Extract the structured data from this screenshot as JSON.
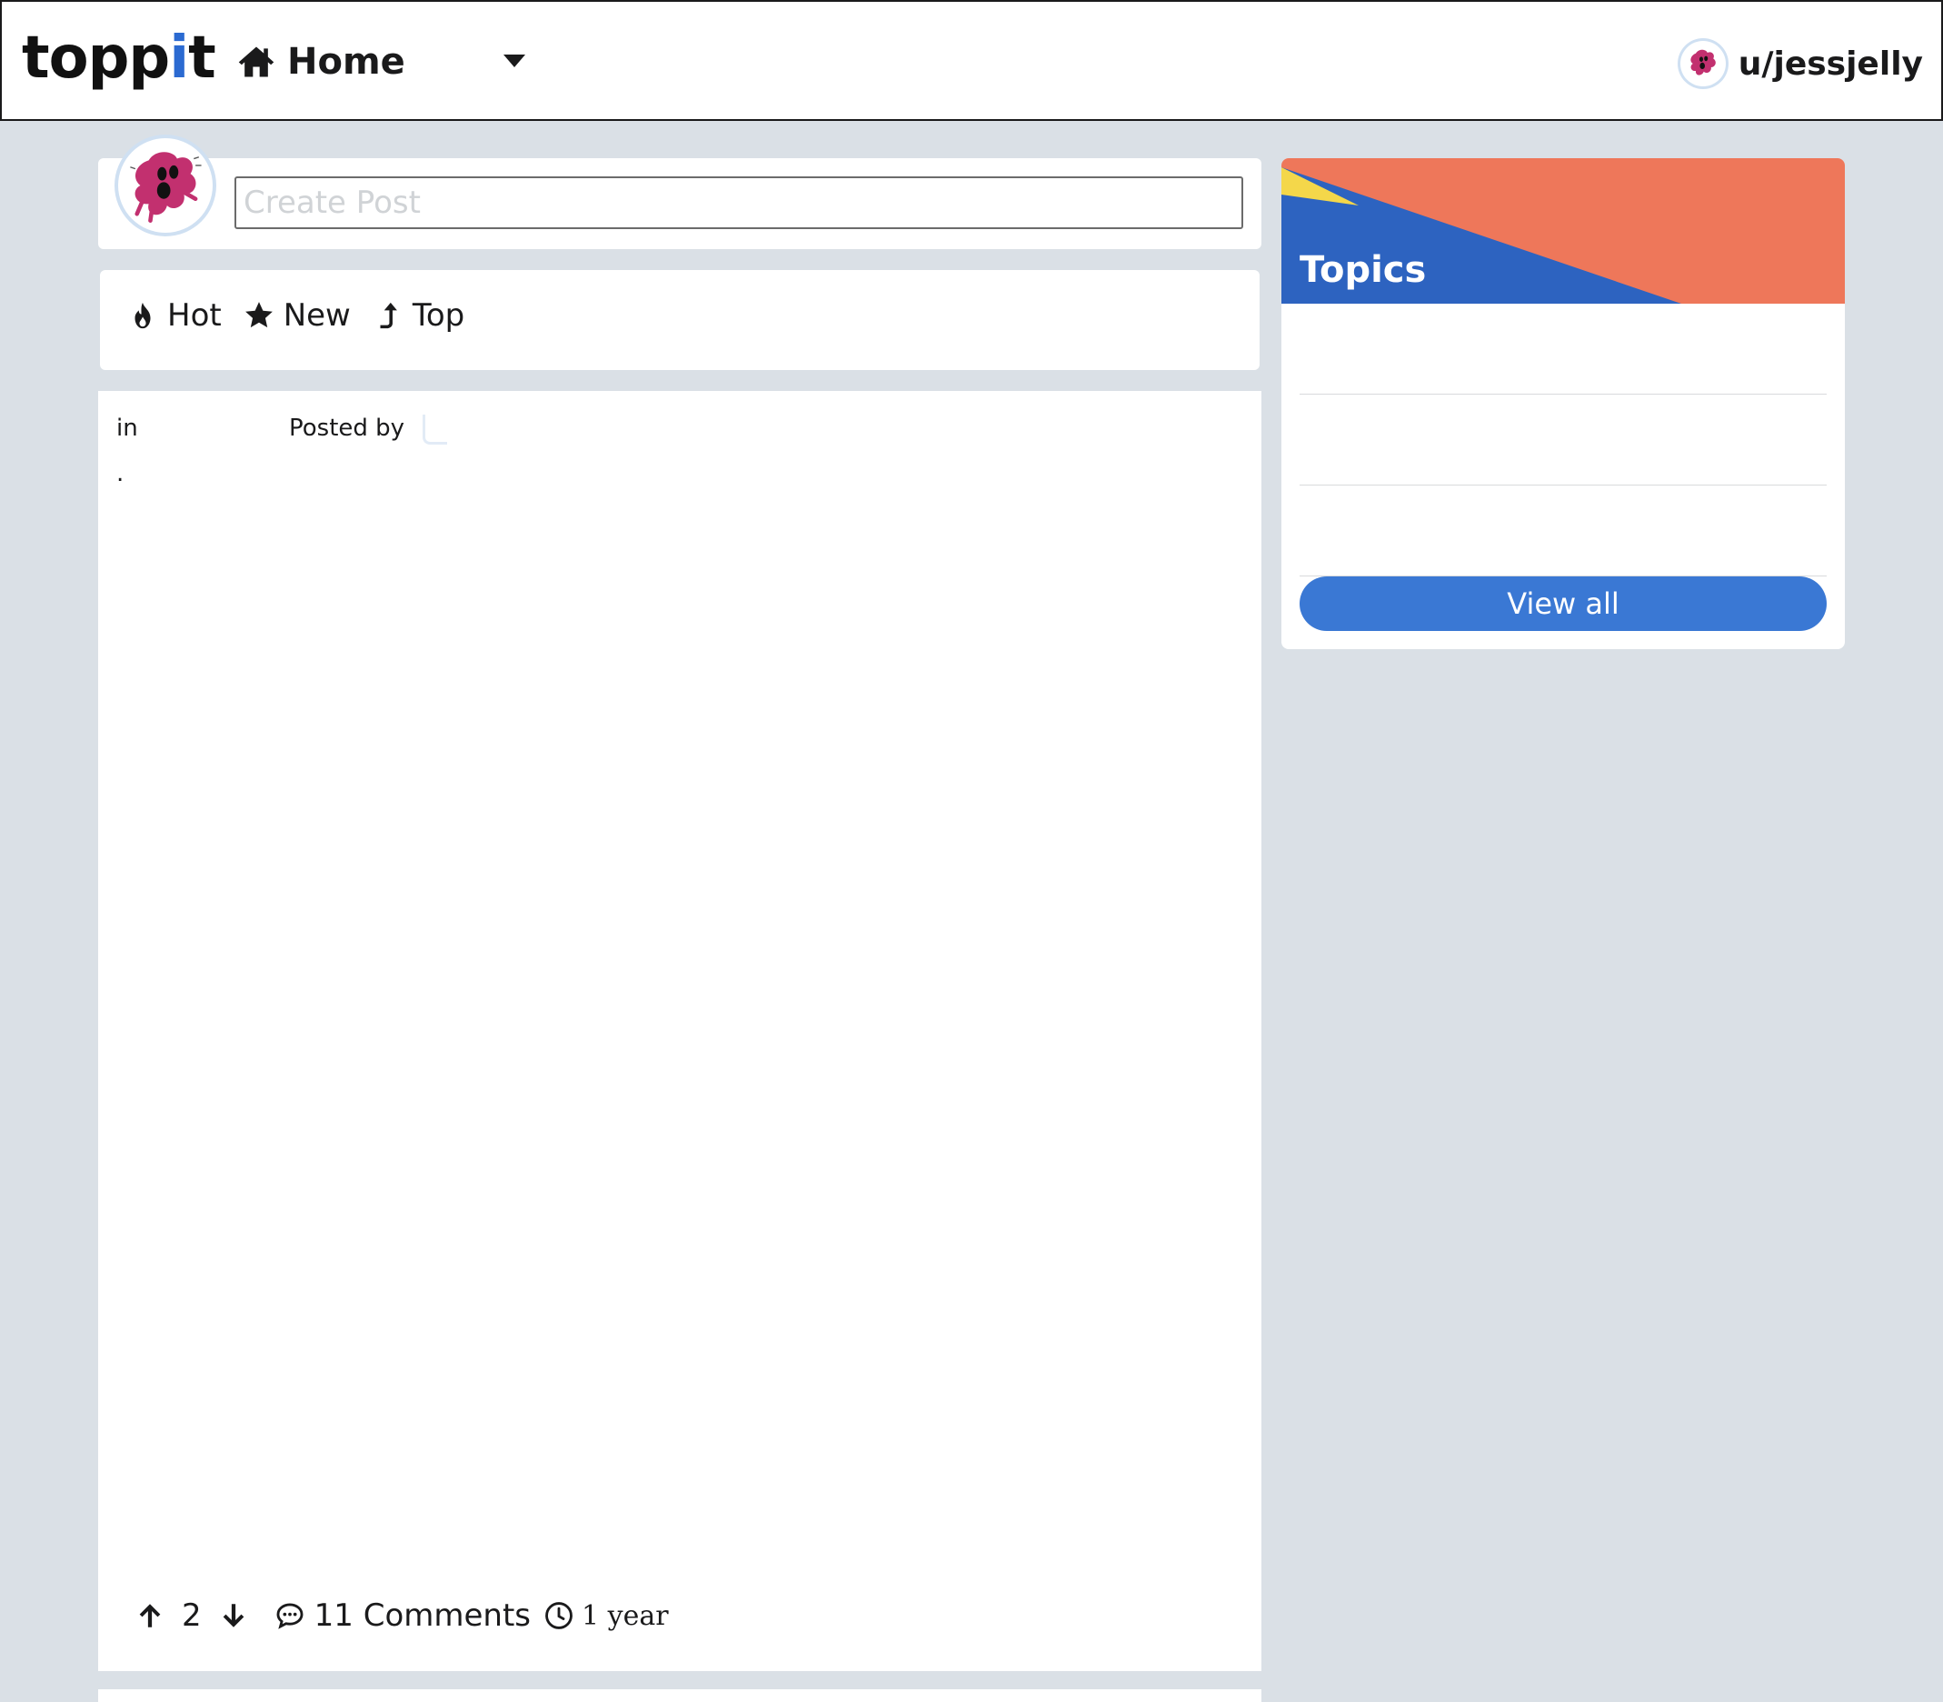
{
  "header": {
    "logo_left": "topp",
    "logo_accent": "i",
    "logo_right": "t",
    "home_label": "Home",
    "username": "u/jessjelly"
  },
  "composer": {
    "placeholder": "Create Post"
  },
  "sort": {
    "items": [
      {
        "label": "Hot",
        "icon": "fire-icon"
      },
      {
        "label": "New",
        "icon": "star-icon"
      },
      {
        "label": "Top",
        "icon": "arrow-up-turn-icon"
      }
    ]
  },
  "post": {
    "in_label": "in",
    "posted_by_label": "Posted by",
    "body_dot": ".",
    "votes": "2",
    "comments_label": "11 Comments",
    "age": "1 year"
  },
  "sidebar": {
    "title": "Topics",
    "topics": [
      "",
      "",
      ""
    ],
    "view_all_label": "View all"
  },
  "colors": {
    "page_bg": "#dae0e6",
    "banner_orange": "#ee775a",
    "banner_blue": "#2d63c0",
    "banner_yellow": "#f4d74a",
    "button_blue": "#3a78d4",
    "logo_accent": "#2b6ad1"
  }
}
